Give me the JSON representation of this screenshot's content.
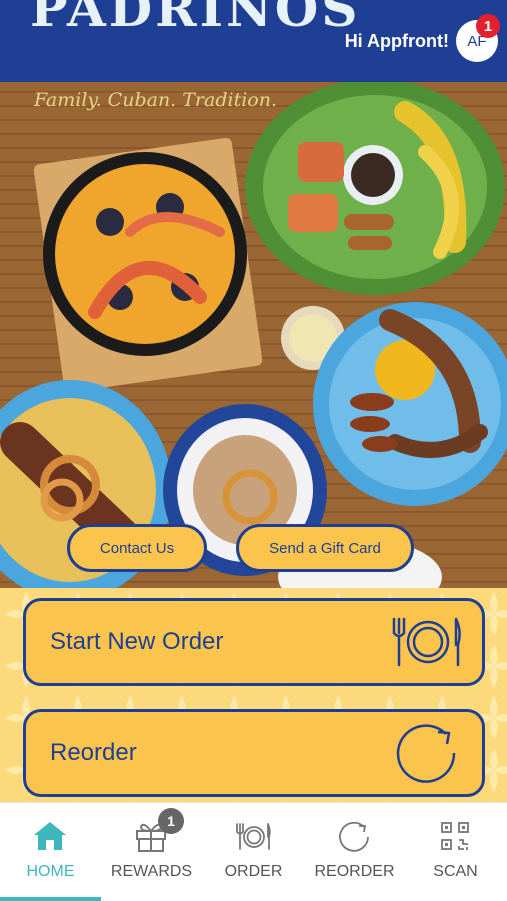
{
  "header": {
    "logo": "PADRINOS",
    "greeting": "Hi Appfront!",
    "avatar_initials": "AF",
    "notification_count": "1"
  },
  "hero": {
    "tagline": "Family. Cuban. Tradition.",
    "contact_label": "Contact Us",
    "gift_label": "Send a Gift Card"
  },
  "actions": {
    "start_order_label": "Start New Order",
    "reorder_label": "Reorder"
  },
  "nav": {
    "items": [
      {
        "label": "HOME",
        "icon": "home-icon",
        "active": true
      },
      {
        "label": "REWARDS",
        "icon": "gift-icon",
        "badge": "1"
      },
      {
        "label": "ORDER",
        "icon": "plate-icon"
      },
      {
        "label": "REORDER",
        "icon": "refresh-icon"
      },
      {
        "label": "SCAN",
        "icon": "qr-code-icon"
      }
    ]
  },
  "colors": {
    "brand_blue": "#1e3f94",
    "button_yellow": "#fbc44d",
    "active_teal": "#3fb7bf",
    "badge_red": "#e3212e"
  }
}
